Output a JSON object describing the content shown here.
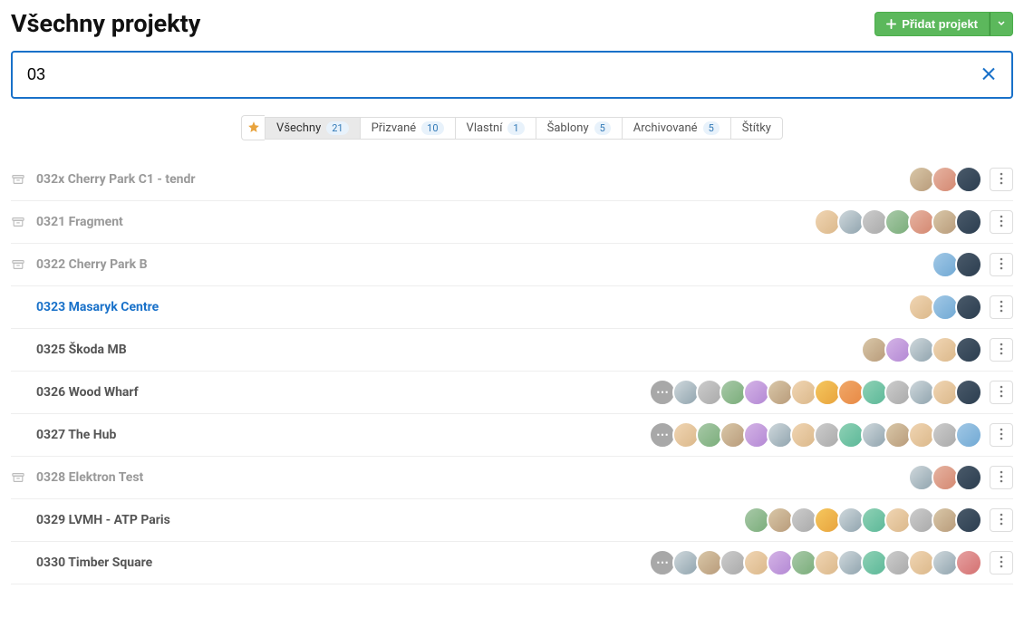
{
  "header": {
    "title": "Všechny projekty",
    "add_button": "Přidat projekt"
  },
  "search": {
    "value": "03"
  },
  "tabs": [
    {
      "label": "Všechny",
      "count": "21",
      "active": true
    },
    {
      "label": "Přizvané",
      "count": "10",
      "active": false
    },
    {
      "label": "Vlastní",
      "count": "1",
      "active": false
    },
    {
      "label": "Šablony",
      "count": "5",
      "active": false
    },
    {
      "label": "Archivované",
      "count": "5",
      "active": false
    },
    {
      "label": "Štítky",
      "count": null,
      "active": false
    }
  ],
  "projects": [
    {
      "name": "032x Cherry Park C1 - tendr",
      "archived": true,
      "highlighted": false,
      "has_more_avatars": false,
      "avatars": [
        0,
        1,
        2
      ]
    },
    {
      "name": "0321 Fragment",
      "archived": true,
      "highlighted": false,
      "has_more_avatars": false,
      "avatars": [
        3,
        4,
        10,
        5,
        1,
        0,
        2
      ]
    },
    {
      "name": "0322 Cherry Park B",
      "archived": true,
      "highlighted": false,
      "has_more_avatars": false,
      "avatars": [
        8,
        2
      ]
    },
    {
      "name": "0323 Masaryk Centre",
      "archived": false,
      "highlighted": true,
      "has_more_avatars": false,
      "avatars": [
        3,
        8,
        2
      ]
    },
    {
      "name": "0325 Škoda MB",
      "archived": false,
      "highlighted": false,
      "has_more_avatars": false,
      "avatars": [
        0,
        6,
        4,
        3,
        2
      ]
    },
    {
      "name": "0326 Wood Wharf",
      "archived": false,
      "highlighted": false,
      "has_more_avatars": true,
      "avatars": [
        4,
        10,
        5,
        6,
        0,
        3,
        7,
        12,
        11,
        10,
        4,
        3,
        2
      ]
    },
    {
      "name": "0327 The Hub",
      "archived": false,
      "highlighted": false,
      "has_more_avatars": true,
      "avatars": [
        3,
        5,
        0,
        6,
        4,
        3,
        10,
        11,
        4,
        0,
        3,
        10,
        8
      ]
    },
    {
      "name": "0328 Elektron Test",
      "archived": true,
      "highlighted": false,
      "has_more_avatars": false,
      "avatars": [
        4,
        1,
        2
      ]
    },
    {
      "name": "0329 LVMH - ATP Paris",
      "archived": false,
      "highlighted": false,
      "has_more_avatars": false,
      "avatars": [
        5,
        0,
        10,
        7,
        4,
        11,
        3,
        10,
        0,
        2
      ]
    },
    {
      "name": "0330 Timber Square",
      "archived": false,
      "highlighted": false,
      "has_more_avatars": true,
      "avatars": [
        4,
        0,
        10,
        3,
        6,
        5,
        3,
        4,
        11,
        10,
        3,
        4,
        9
      ]
    }
  ]
}
